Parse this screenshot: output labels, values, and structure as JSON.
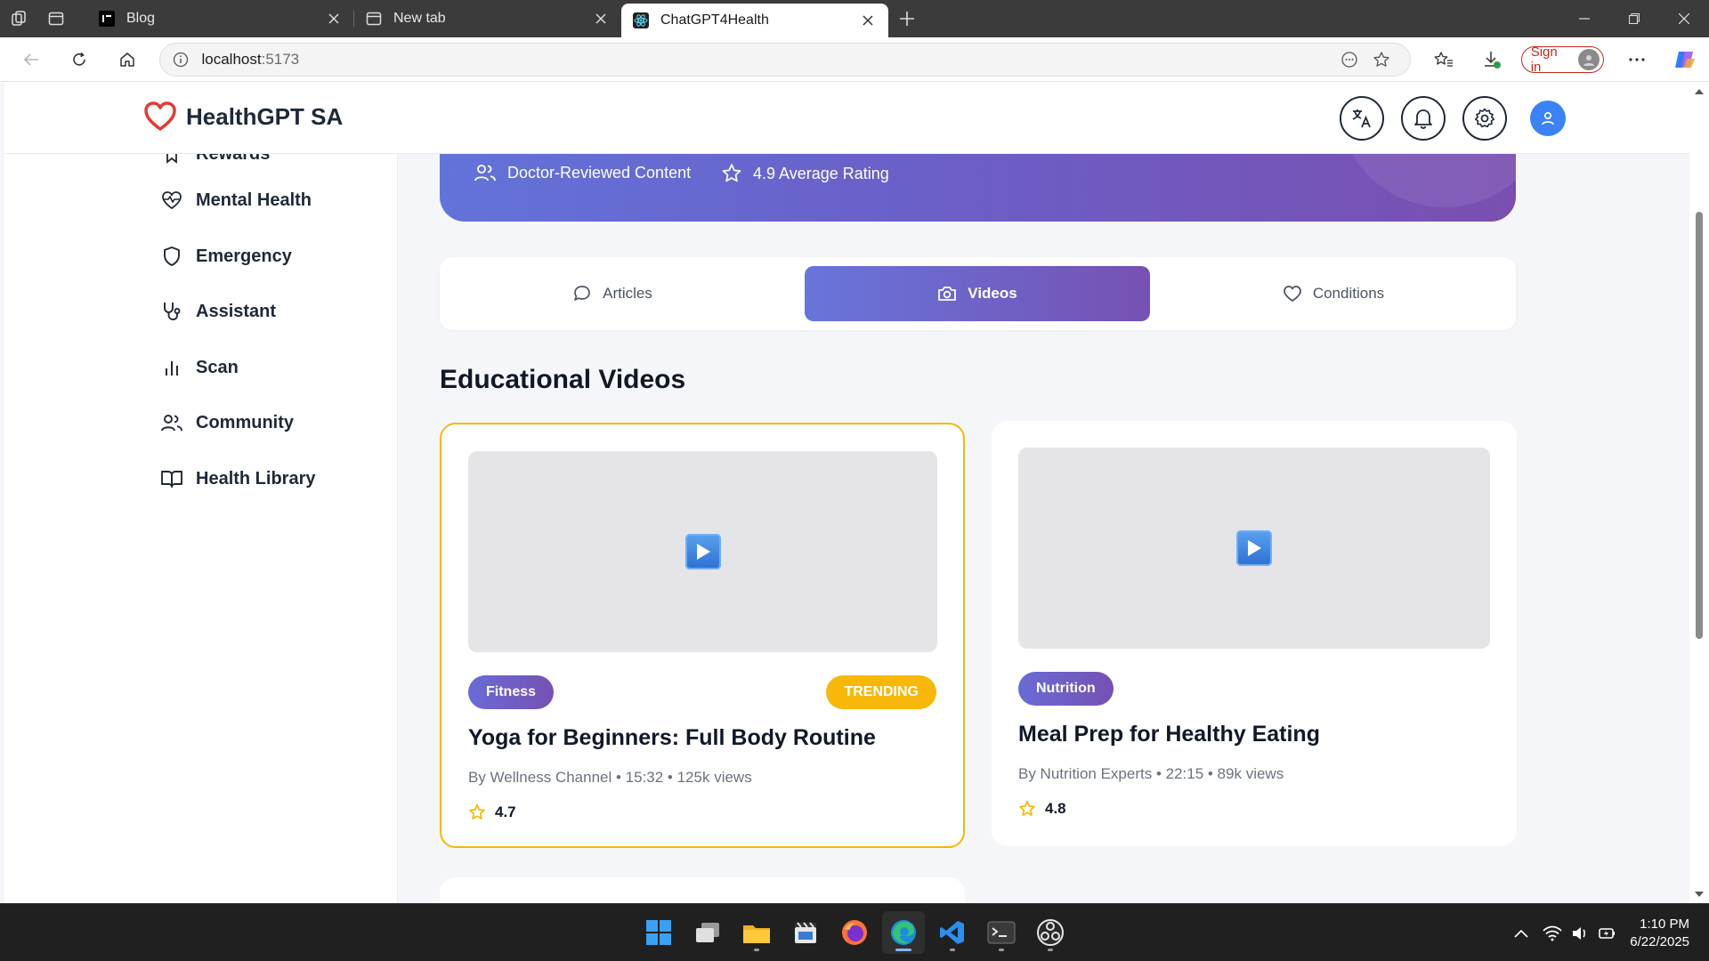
{
  "browser": {
    "tabs": [
      {
        "title": "Blog",
        "icon": "blog-favicon",
        "active": false
      },
      {
        "title": "New tab",
        "icon": "newtab-favicon",
        "active": false
      },
      {
        "title": "ChatGPT4Health",
        "icon": "react-favicon",
        "active": true
      }
    ],
    "url_host": "localhost",
    "url_port": ":5173",
    "signin_label": "Sign in"
  },
  "app": {
    "brand": "HealthGPT SA",
    "brand_color": "#e53935",
    "accent": "#6a6bd6",
    "header_buttons": [
      "translate-icon",
      "bell-icon",
      "gear-icon",
      "user-icon"
    ]
  },
  "sidebar": {
    "partial_item": "Rewards",
    "items": [
      {
        "label": "Mental Health",
        "icon": "heart-pulse-icon"
      },
      {
        "label": "Emergency",
        "icon": "shield-icon"
      },
      {
        "label": "Assistant",
        "icon": "stethoscope-icon"
      },
      {
        "label": "Scan",
        "icon": "bar-chart-icon"
      },
      {
        "label": "Community",
        "icon": "users-icon"
      },
      {
        "label": "Health Library",
        "icon": "book-icon"
      }
    ]
  },
  "hero": {
    "stat1": "Doctor-Reviewed Content",
    "stat2": "4.9 Average Rating"
  },
  "content_tabs": [
    {
      "label": "Articles",
      "icon": "message-icon",
      "active": false
    },
    {
      "label": "Videos",
      "icon": "camera-icon",
      "active": true
    },
    {
      "label": "Conditions",
      "icon": "heart-icon",
      "active": false
    }
  ],
  "section_title": "Educational Videos",
  "videos": [
    {
      "category": "Fitness",
      "badge": "TRENDING",
      "title": "Yoga for Beginners: Full Body Routine",
      "meta": "By Wellness Channel • 15:32 • 125k views",
      "rating": "4.7",
      "featured": true
    },
    {
      "category": "Nutrition",
      "badge": "",
      "title": "Meal Prep for Healthy Eating",
      "meta": "By Nutrition Experts • 22:15 • 89k views",
      "rating": "4.8",
      "featured": false
    }
  ],
  "taskbar": {
    "time": "1:10 PM",
    "date": "6/22/2025"
  }
}
